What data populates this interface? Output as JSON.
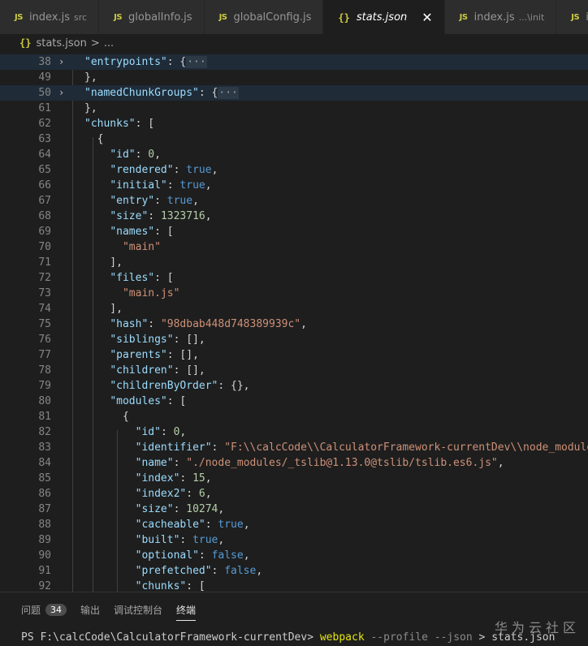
{
  "tabs": [
    {
      "icon": "JS",
      "name": "index.js",
      "description": "src",
      "active": false
    },
    {
      "icon": "JS",
      "name": "globalInfo.js",
      "description": "",
      "active": false
    },
    {
      "icon": "JS",
      "name": "globalConfig.js",
      "description": "",
      "active": false
    },
    {
      "icon": "{}",
      "name": "stats.json",
      "description": "",
      "active": true,
      "close": "✕"
    },
    {
      "icon": "JS",
      "name": "index.js",
      "description": "...\\init",
      "active": false
    },
    {
      "icon": "JS",
      "name": "inde",
      "description": "",
      "active": false
    }
  ],
  "breadcrumb": {
    "icon": "{}",
    "file": "stats.json",
    "separator": ">",
    "rest": "..."
  },
  "editor": {
    "lines": [
      {
        "num": "38",
        "fold": "›",
        "hl": true
      },
      {
        "num": "49"
      },
      {
        "num": "50",
        "fold": "›",
        "hl": true
      },
      {
        "num": "61"
      },
      {
        "num": "62"
      },
      {
        "num": "63"
      },
      {
        "num": "64"
      },
      {
        "num": "65"
      },
      {
        "num": "66"
      },
      {
        "num": "67"
      },
      {
        "num": "68"
      },
      {
        "num": "69"
      },
      {
        "num": "70"
      },
      {
        "num": "71"
      },
      {
        "num": "72"
      },
      {
        "num": "73"
      },
      {
        "num": "74"
      },
      {
        "num": "75"
      },
      {
        "num": "76"
      },
      {
        "num": "77"
      },
      {
        "num": "78"
      },
      {
        "num": "79"
      },
      {
        "num": "80"
      },
      {
        "num": "81"
      },
      {
        "num": "82"
      },
      {
        "num": "83"
      },
      {
        "num": "84"
      },
      {
        "num": "85"
      },
      {
        "num": "86"
      },
      {
        "num": "87"
      },
      {
        "num": "88"
      },
      {
        "num": "89"
      },
      {
        "num": "90"
      },
      {
        "num": "91"
      },
      {
        "num": "92"
      }
    ],
    "code": [
      [
        [
          "k",
          "\"entrypoints\""
        ],
        [
          "p",
          ": {"
        ],
        [
          "ell",
          "···"
        ]
      ],
      [
        [
          "p",
          "},"
        ]
      ],
      [
        [
          "k",
          "\"namedChunkGroups\""
        ],
        [
          "p",
          ": {"
        ],
        [
          "ell",
          "···"
        ]
      ],
      [
        [
          "p",
          "},"
        ]
      ],
      [
        [
          "k",
          "\"chunks\""
        ],
        [
          "p",
          ": ["
        ]
      ],
      [
        [
          "p",
          "  {"
        ]
      ],
      [
        [
          "p",
          "    "
        ],
        [
          "k",
          "\"id\""
        ],
        [
          "p",
          ": "
        ],
        [
          "n",
          "0"
        ],
        [
          "p",
          ","
        ]
      ],
      [
        [
          "p",
          "    "
        ],
        [
          "k",
          "\"rendered\""
        ],
        [
          "p",
          ": "
        ],
        [
          "b",
          "true"
        ],
        [
          "p",
          ","
        ]
      ],
      [
        [
          "p",
          "    "
        ],
        [
          "k",
          "\"initial\""
        ],
        [
          "p",
          ": "
        ],
        [
          "b",
          "true"
        ],
        [
          "p",
          ","
        ]
      ],
      [
        [
          "p",
          "    "
        ],
        [
          "k",
          "\"entry\""
        ],
        [
          "p",
          ": "
        ],
        [
          "b",
          "true"
        ],
        [
          "p",
          ","
        ]
      ],
      [
        [
          "p",
          "    "
        ],
        [
          "k",
          "\"size\""
        ],
        [
          "p",
          ": "
        ],
        [
          "n",
          "1323716"
        ],
        [
          "p",
          ","
        ]
      ],
      [
        [
          "p",
          "    "
        ],
        [
          "k",
          "\"names\""
        ],
        [
          "p",
          ": ["
        ]
      ],
      [
        [
          "p",
          "      "
        ],
        [
          "s",
          "\"main\""
        ]
      ],
      [
        [
          "p",
          "    ],"
        ]
      ],
      [
        [
          "p",
          "    "
        ],
        [
          "k",
          "\"files\""
        ],
        [
          "p",
          ": ["
        ]
      ],
      [
        [
          "p",
          "      "
        ],
        [
          "s",
          "\"main.js\""
        ]
      ],
      [
        [
          "p",
          "    ],"
        ]
      ],
      [
        [
          "p",
          "    "
        ],
        [
          "k",
          "\"hash\""
        ],
        [
          "p",
          ": "
        ],
        [
          "s",
          "\"98dbab448d748389939c\""
        ],
        [
          "p",
          ","
        ]
      ],
      [
        [
          "p",
          "    "
        ],
        [
          "k",
          "\"siblings\""
        ],
        [
          "p",
          ": [],"
        ]
      ],
      [
        [
          "p",
          "    "
        ],
        [
          "k",
          "\"parents\""
        ],
        [
          "p",
          ": [],"
        ]
      ],
      [
        [
          "p",
          "    "
        ],
        [
          "k",
          "\"children\""
        ],
        [
          "p",
          ": [],"
        ]
      ],
      [
        [
          "p",
          "    "
        ],
        [
          "k",
          "\"childrenByOrder\""
        ],
        [
          "p",
          ": {},"
        ]
      ],
      [
        [
          "p",
          "    "
        ],
        [
          "k",
          "\"modules\""
        ],
        [
          "p",
          ": ["
        ]
      ],
      [
        [
          "p",
          "      {"
        ]
      ],
      [
        [
          "p",
          "        "
        ],
        [
          "k",
          "\"id\""
        ],
        [
          "p",
          ": "
        ],
        [
          "n",
          "0"
        ],
        [
          "p",
          ","
        ]
      ],
      [
        [
          "p",
          "        "
        ],
        [
          "k",
          "\"identifier\""
        ],
        [
          "p",
          ": "
        ],
        [
          "s",
          "\"F:\\\\calcCode\\\\CalculatorFramework-currentDev\\\\node_module"
        ]
      ],
      [
        [
          "p",
          "        "
        ],
        [
          "k",
          "\"name\""
        ],
        [
          "p",
          ": "
        ],
        [
          "s",
          "\"./node_modules/_tslib@1.13.0@tslib/tslib.es6.js\""
        ],
        [
          "p",
          ","
        ]
      ],
      [
        [
          "p",
          "        "
        ],
        [
          "k",
          "\"index\""
        ],
        [
          "p",
          ": "
        ],
        [
          "n",
          "15"
        ],
        [
          "p",
          ","
        ]
      ],
      [
        [
          "p",
          "        "
        ],
        [
          "k",
          "\"index2\""
        ],
        [
          "p",
          ": "
        ],
        [
          "n",
          "6"
        ],
        [
          "p",
          ","
        ]
      ],
      [
        [
          "p",
          "        "
        ],
        [
          "k",
          "\"size\""
        ],
        [
          "p",
          ": "
        ],
        [
          "n",
          "10274"
        ],
        [
          "p",
          ","
        ]
      ],
      [
        [
          "p",
          "        "
        ],
        [
          "k",
          "\"cacheable\""
        ],
        [
          "p",
          ": "
        ],
        [
          "b",
          "true"
        ],
        [
          "p",
          ","
        ]
      ],
      [
        [
          "p",
          "        "
        ],
        [
          "k",
          "\"built\""
        ],
        [
          "p",
          ": "
        ],
        [
          "b",
          "true"
        ],
        [
          "p",
          ","
        ]
      ],
      [
        [
          "p",
          "        "
        ],
        [
          "k",
          "\"optional\""
        ],
        [
          "p",
          ": "
        ],
        [
          "b",
          "false"
        ],
        [
          "p",
          ","
        ]
      ],
      [
        [
          "p",
          "        "
        ],
        [
          "k",
          "\"prefetched\""
        ],
        [
          "p",
          ": "
        ],
        [
          "b",
          "false"
        ],
        [
          "p",
          ","
        ]
      ],
      [
        [
          "p",
          "        "
        ],
        [
          "k",
          "\"chunks\""
        ],
        [
          "p",
          ": ["
        ]
      ]
    ]
  },
  "panel": {
    "tabs": [
      {
        "label": "问题",
        "badge": "34",
        "active": false
      },
      {
        "label": "输出",
        "active": false
      },
      {
        "label": "调试控制台",
        "active": false
      },
      {
        "label": "终端",
        "active": true
      }
    ],
    "terminal": {
      "prompt": "PS F:\\calcCode\\CalculatorFramework-currentDev> ",
      "command": "webpack",
      "flags": " --profile --json",
      "rest": " > stats.json"
    },
    "watermark": "华为云社区"
  }
}
